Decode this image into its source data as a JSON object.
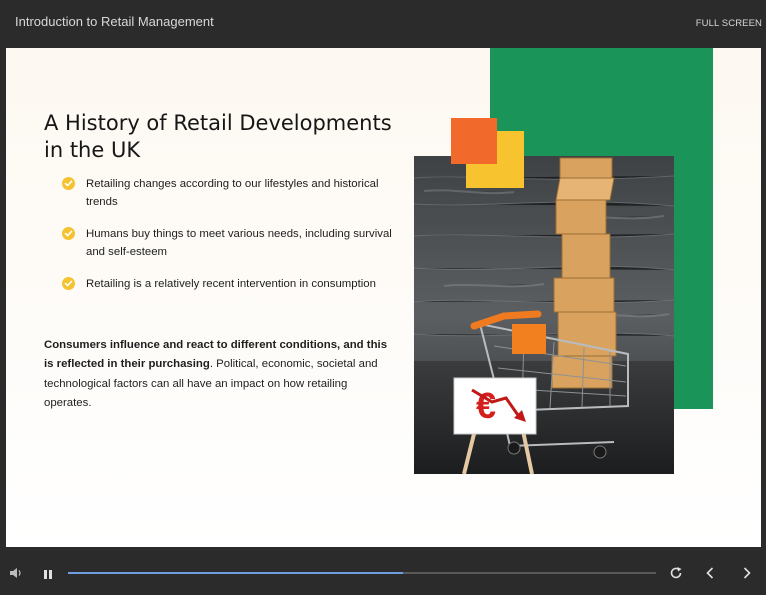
{
  "header": {
    "course_title": "Introduction to Retail Management",
    "fullscreen_label": "FULL SCREEN"
  },
  "slide": {
    "title": "A History of Retail Developments in the UK",
    "bullets": [
      "Retailing changes according to our lifestyles and historical trends",
      "Humans buy things to meet various needs, including survival and self-esteem",
      "Retailing is a relatively recent intervention in consumption"
    ],
    "paragraph_bold": "Consumers influence and react to different conditions, and this is reflected in their purchasing",
    "paragraph_rest": ". Political, economic, societal and technological factors can all have an impact on how retailing operates.",
    "image_sign_symbol": "€"
  },
  "player": {
    "progress": 0.57,
    "icons": [
      "volume-icon",
      "pause-icon",
      "replay-icon",
      "previous-icon",
      "next-icon"
    ]
  },
  "colors": {
    "accent_green": "#1a9459",
    "accent_orange": "#f2692c",
    "accent_yellow": "#f7c42f",
    "check_yellow": "#f5c330",
    "progress_blue": "#6f9ee0"
  }
}
